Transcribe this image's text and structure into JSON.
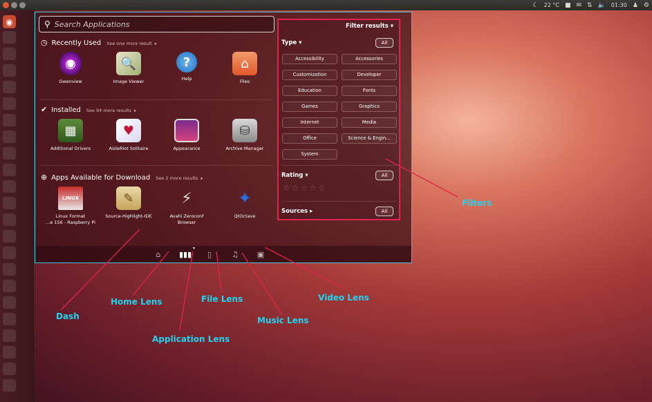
{
  "top_panel": {
    "weather": "22 °C",
    "time": "01:30",
    "icons": [
      "weather-icon",
      "keyboard-icon",
      "mail-icon",
      "network-icon",
      "volume-icon",
      "user-icon",
      "gear-icon"
    ]
  },
  "search": {
    "placeholder": "Search Applications"
  },
  "recently_used": {
    "title": "Recently Used",
    "more": "See one more result",
    "apps": [
      "Gwenview",
      "Image Viewer",
      "Help",
      "Files"
    ]
  },
  "installed": {
    "title": "Installed",
    "more": "See 94 more results",
    "apps": [
      "Additional Drivers",
      "AisleRiot Solitaire",
      "Appearance",
      "Archive Manager"
    ]
  },
  "available": {
    "title": "Apps Available for Download",
    "more": "See 2 more results",
    "apps": [
      {
        "line1": "Linux Format",
        "line2": "...e 156 - Raspberry Pi"
      },
      {
        "line1": "Source-Highlight-IDE",
        "line2": ""
      },
      {
        "line1": "Avahi Zeroconf",
        "line2": "Browser"
      },
      {
        "line1": "QtOctave",
        "line2": ""
      }
    ]
  },
  "filters": {
    "title": "Filter results",
    "type_label": "Type",
    "rating_label": "Rating",
    "sources_label": "Sources",
    "all": "All",
    "types": [
      "Accessibility",
      "Accessories",
      "Customization",
      "Developer",
      "Education",
      "Fonts",
      "Games",
      "Graphics",
      "Internet",
      "Media",
      "Office",
      "Science & Engin...",
      "System"
    ]
  },
  "annotations": {
    "dash": "Dash",
    "home_lens": "Home Lens",
    "application_lens": "Application Lens",
    "file_lens": "File Lens",
    "music_lens": "Music Lens",
    "video_lens": "Video Lens",
    "filters": "Filters"
  },
  "colors": {
    "highlight_dash": "#3fc4da",
    "highlight_filters": "#e0244d",
    "annotation_text": "#22d3f0"
  }
}
